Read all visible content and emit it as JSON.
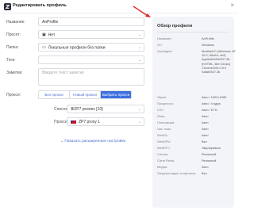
{
  "header": {
    "title": "Редактировать профиль",
    "close": "×"
  },
  "form": {
    "name_label": "Название:",
    "name_value": "AnProfile",
    "preset_label": "Пресет:",
    "preset_value": "Нет",
    "folder_label": "Папка:",
    "folder_value": "Локальные профили без папки",
    "tags_label": "Теги:",
    "notes_label": "Заметки:",
    "notes_placeholder": "Введите текст заметки",
    "proxy_label": "Прокси:",
    "proxy_tabs": [
      "Без прокси",
      "Новый прокси",
      "Выбрать прокси"
    ],
    "list_label": "Список:",
    "list_value": "ZP7 proxies [10]",
    "proxy_sel_label": "Прокси:",
    "proxy_sel_value": "ZP7 proxy 1",
    "extra_link": "⌄ Показать расширенные настройки"
  },
  "panel": {
    "title": "Обзор профиля",
    "rows": [
      {
        "k": "Название:",
        "v": "AnProfile"
      },
      {
        "k": "ОС:",
        "v": "Windows"
      },
      {
        "k": "UserAgent:",
        "v": "Mozilla/5.0 (Windows NT 10.0; Win64; x64) AppleWebKit/537.36 (KHTML, like Gecko) Chrome/104.0.0.0 Safari/537.36"
      },
      {
        "k": "Экран:",
        "v": "Авто / 1920×1080"
      },
      {
        "k": "Процессор:",
        "v": "Авто / 4 ядра"
      },
      {
        "k": "ОЗУ:",
        "v": "Авто / 8 ГБ"
      },
      {
        "k": "Язык:",
        "v": "Авто"
      },
      {
        "k": "Геопозиция:",
        "v": "Авто"
      },
      {
        "k": "Час. пояс:",
        "v": "Авто"
      },
      {
        "k": "WebGL:",
        "v": "Авто"
      },
      {
        "k": "WebGPU:",
        "v": "Вкл"
      },
      {
        "k": "WebRTC:",
        "v": "Эмулировать"
      },
      {
        "k": "Canvas:",
        "v": "Реальный"
      },
      {
        "k": "Client Rects:",
        "v": "Реальный"
      },
      {
        "k": "Медиа:",
        "v": "Авто"
      },
      {
        "k": "Загрузка видео и картинок:",
        "v": "Вкл"
      }
    ]
  },
  "colors": {
    "accent": "#3d6fe0",
    "arrow": "#e0282e",
    "panel_bg": "#f2f4f8"
  }
}
